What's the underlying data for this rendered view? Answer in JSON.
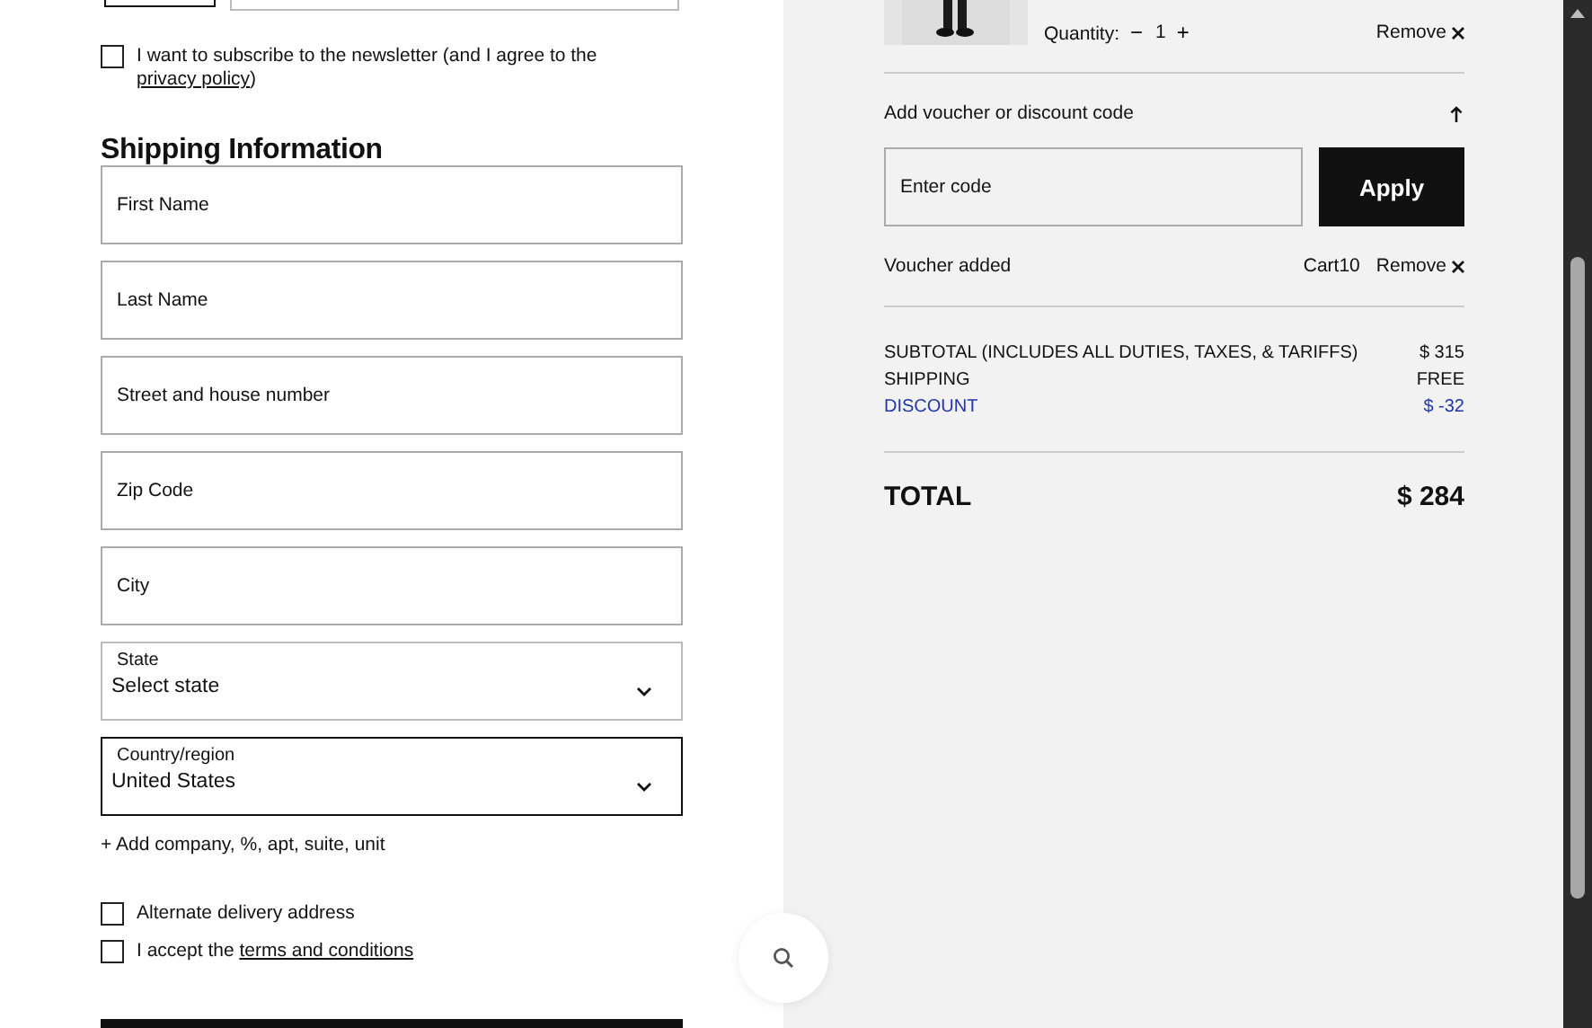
{
  "newsletter": {
    "checked": false,
    "text": "I want to subscribe to the newsletter (and I agree to the ",
    "link": "privacy policy",
    "after": ")"
  },
  "shipping": {
    "title": "Shipping Information",
    "fields": [
      {
        "placeholder": "First Name"
      },
      {
        "placeholder": "Last Name"
      },
      {
        "placeholder": "Street and house number"
      },
      {
        "placeholder": "Zip Code"
      },
      {
        "placeholder": "City"
      }
    ],
    "selects": [
      {
        "label": "State",
        "value": "Select state",
        "focused": false
      },
      {
        "label": "Country/region",
        "value": "United States",
        "focused": true
      }
    ],
    "add_link": "+ Add company, %, apt, suite, unit",
    "checkboxes": [
      {
        "kind": "plain",
        "text": "Alternate delivery address",
        "checked": false
      },
      {
        "kind": "terms",
        "text": "I accept the ",
        "link": "terms and conditions",
        "checked": false
      }
    ]
  },
  "cart": {
    "quantity_label": "Quantity:",
    "minus": "−",
    "quantity": "1",
    "plus": "+",
    "remove": "Remove"
  },
  "voucher": {
    "title": "Add voucher or discount code",
    "expanded": true,
    "placeholder": "Enter code",
    "apply": "Apply",
    "added_label": "Voucher added",
    "code": "Cart10",
    "remove": "Remove"
  },
  "summary": {
    "rows": [
      {
        "kind": "normal",
        "label": "SUBTOTAL (INCLUDES ALL DUTIES, TAXES, & TARIFFS)",
        "value": "$ 315"
      },
      {
        "kind": "normal",
        "label": "SHIPPING",
        "value": "FREE"
      },
      {
        "kind": "discount",
        "label": "DISCOUNT",
        "value": "$ -32"
      }
    ],
    "total_label": "TOTAL",
    "total": "$ 284"
  }
}
